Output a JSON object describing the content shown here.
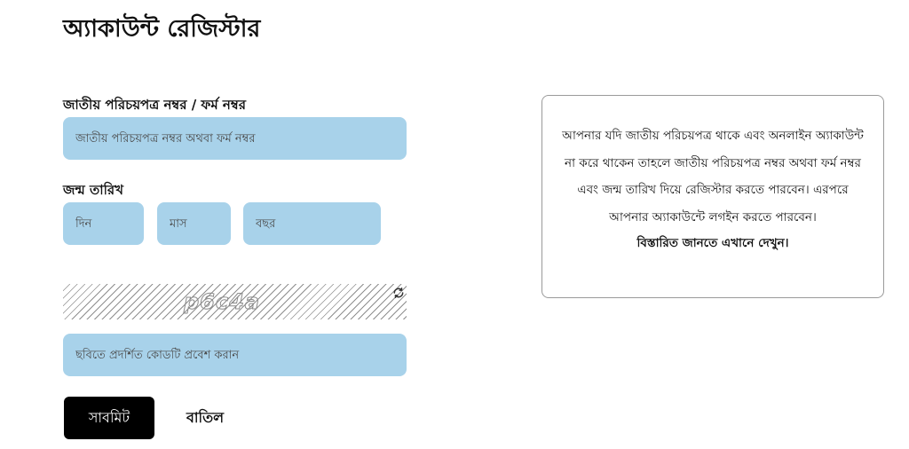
{
  "page": {
    "title": "অ্যাকাউন্ট রেজিস্টার"
  },
  "form": {
    "nid_label": "জাতীয় পরিচয়পত্র নম্বর / ফর্ম নম্বর",
    "nid_placeholder": "জাতীয় পরিচয়পত্র নম্বর অথবা ফর্ম নম্বর",
    "dob_label": "জন্ম তারিখ",
    "day_placeholder": "দিন",
    "month_placeholder": "মাস",
    "year_placeholder": "বছর",
    "captcha_text": "p6c4a",
    "captcha_placeholder": "ছবিতে প্রদর্শিত কোডটি প্রবেশ করান",
    "submit_label": "সাবমিট",
    "cancel_label": "বাতিল"
  },
  "info": {
    "text": "আপনার যদি জাতীয় পরিচয়পত্র থাকে এবং অনলাইন অ্যাকাউন্ট না করে থাকেন তাহলে জাতীয় পরিচয়পত্র নম্বর অথবা ফর্ম নম্বর এবং জন্ম তারিখ দিয়ে রেজিস্টার করতে পারবেন। এরপরে আপনার অ্যাকাউন্টে লগইন করতে পারবেন।",
    "link_text": "বিস্তারিত জানতে এখানে দেখুন।"
  },
  "colors": {
    "field_background": "#a8d2ea",
    "submit_background": "#000000",
    "info_border": "#9a9a9a"
  },
  "icons": {
    "captcha_refresh": "refresh-icon"
  }
}
